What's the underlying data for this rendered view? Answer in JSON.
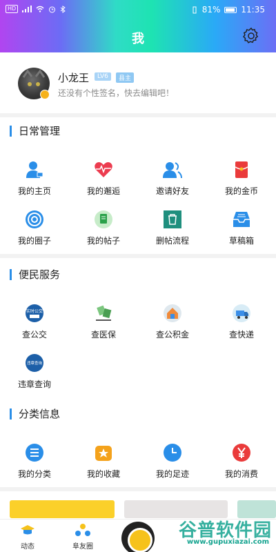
{
  "status_bar": {
    "network": "HD",
    "battery": "81%",
    "time": "11:35"
  },
  "header": {
    "title": "我"
  },
  "profile": {
    "username": "小龙王",
    "level": "LV6",
    "role": "县主",
    "signature": "还没有个性签名，快去编辑吧！"
  },
  "sections": {
    "daily": {
      "title": "日常管理",
      "items": [
        {
          "label": "我的主页",
          "icon": "person-icon",
          "color": "#2a8ee8"
        },
        {
          "label": "我的邂逅",
          "icon": "heartbeat-icon",
          "color": "#ec3c4f"
        },
        {
          "label": "邀请好友",
          "icon": "add-friend-icon",
          "color": "#2a8ee8"
        },
        {
          "label": "我的金币",
          "icon": "red-packet-icon",
          "color": "#ea3b3b"
        },
        {
          "label": "我的圈子",
          "icon": "target-icon",
          "color": "#2a8ee8"
        },
        {
          "label": "我的帖子",
          "icon": "document-icon",
          "color": "#2aa14a"
        },
        {
          "label": "删帖流程",
          "icon": "trash-icon",
          "color": "#1f8f7e"
        },
        {
          "label": "草稿箱",
          "icon": "inbox-icon",
          "color": "#2a8ee8"
        }
      ]
    },
    "service": {
      "title": "便民服务",
      "items": [
        {
          "label": "查公交",
          "icon": "bus-icon",
          "badge_text": "实时公交"
        },
        {
          "label": "查医保",
          "icon": "medical-icon"
        },
        {
          "label": "查公积金",
          "icon": "house-icon"
        },
        {
          "label": "查快递",
          "icon": "delivery-icon"
        },
        {
          "label": "违章查询",
          "icon": "violation-icon",
          "badge_text": "违章查询"
        }
      ]
    },
    "category": {
      "title": "分类信息",
      "items": [
        {
          "label": "我的分类",
          "icon": "list-icon",
          "color": "#2a8ee8"
        },
        {
          "label": "我的收藏",
          "icon": "star-box-icon",
          "color": "#f4a21b"
        },
        {
          "label": "我的足迹",
          "icon": "clock-icon",
          "color": "#2a8ee8"
        },
        {
          "label": "我的消费",
          "icon": "yen-icon",
          "color": "#ea3b3b"
        }
      ]
    }
  },
  "tab_bar": {
    "tabs": [
      {
        "label": "动态",
        "icon": "graduation-cap-icon"
      },
      {
        "label": "阜友圈",
        "icon": "group-icon"
      }
    ]
  },
  "watermark": {
    "text": "谷普软件园",
    "url": "www.gupuxiazai.com"
  },
  "colors": {
    "accent": "#2a8ee8",
    "header_gradient": [
      "#b145f0",
      "#1ee3b2",
      "#6b6ff5"
    ]
  }
}
